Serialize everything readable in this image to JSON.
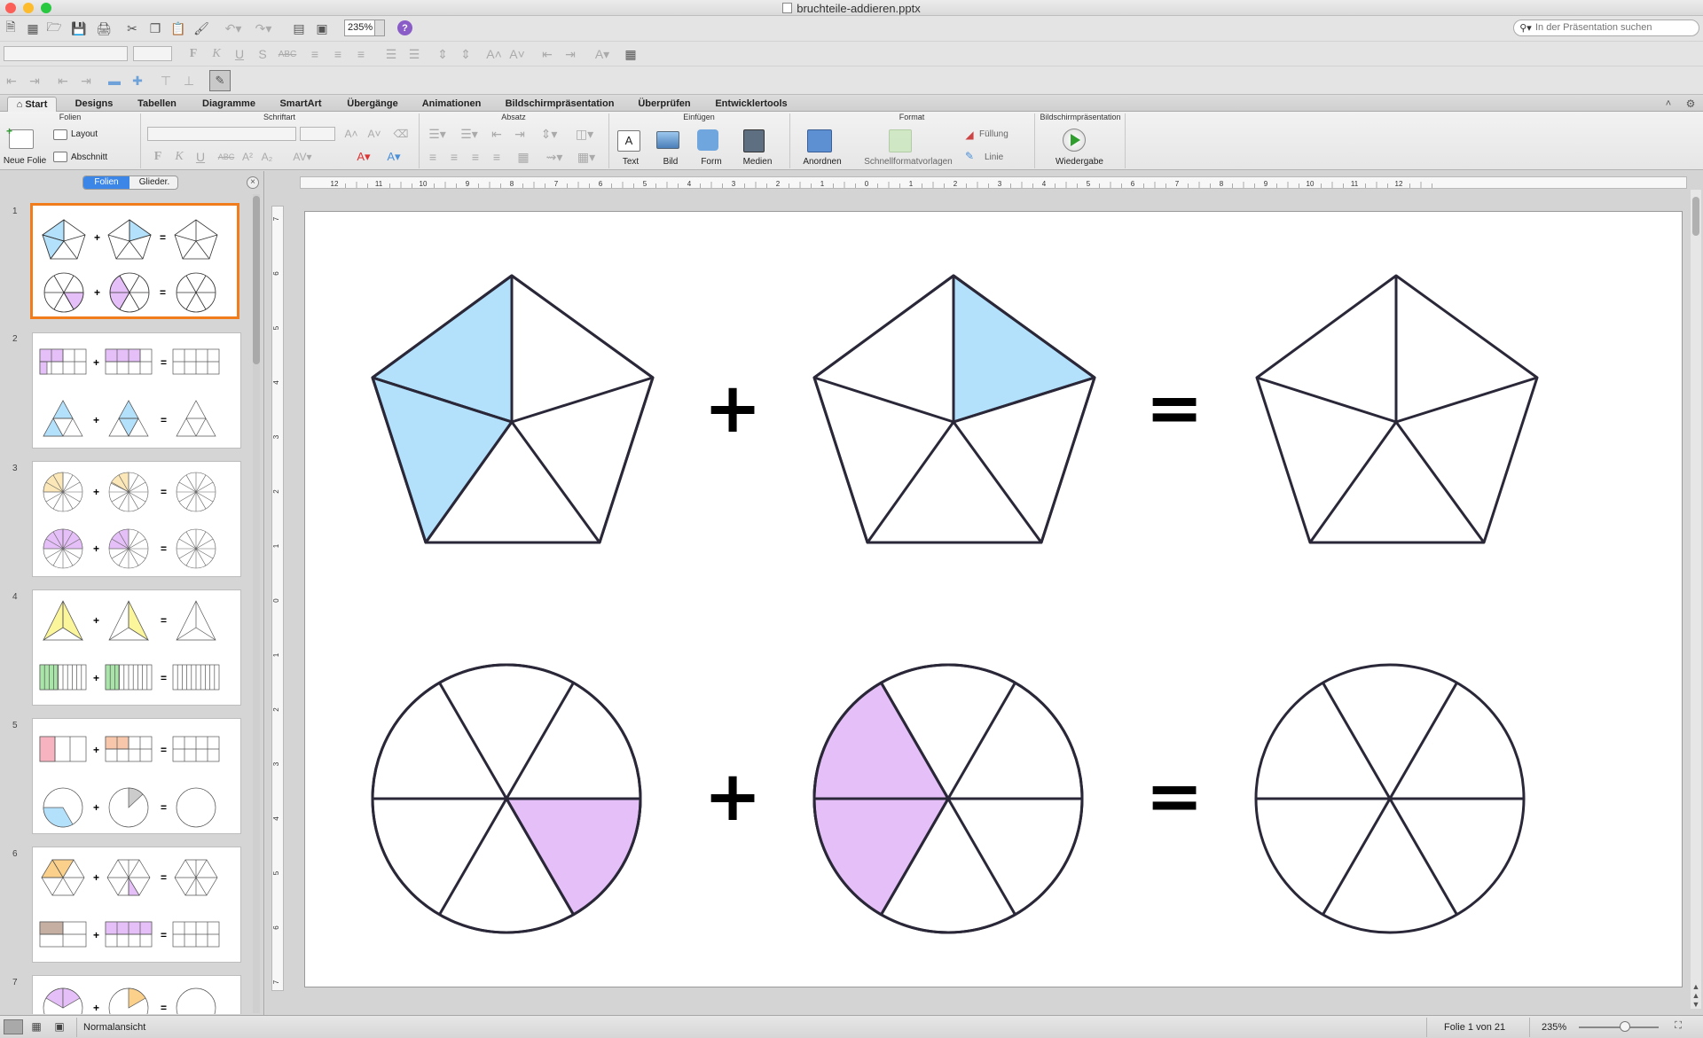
{
  "window": {
    "title": "bruchteile-addieren.pptx",
    "traffic_lights": {
      "close": "#fc5f57",
      "minimize": "#fdbc2e",
      "zoom": "#28c840"
    }
  },
  "toolbar": {
    "zoom_value": "235%",
    "search_placeholder": "In der Präsentation suchen"
  },
  "ribbon_tabs": [
    {
      "label": "Start",
      "active": true
    },
    {
      "label": "Designs"
    },
    {
      "label": "Tabellen"
    },
    {
      "label": "Diagramme"
    },
    {
      "label": "SmartArt"
    },
    {
      "label": "Übergänge"
    },
    {
      "label": "Animationen"
    },
    {
      "label": "Bildschirmpräsentation"
    },
    {
      "label": "Überprüfen"
    },
    {
      "label": "Entwicklertools"
    }
  ],
  "ribbon": {
    "groups": {
      "folien": "Folien",
      "schriftart": "Schriftart",
      "absatz": "Absatz",
      "einfuegen": "Einfügen",
      "format": "Format",
      "bildschirm": "Bildschirmpräsentation"
    },
    "buttons": {
      "neue_folie": "Neue Folie",
      "layout": "Layout",
      "abschnitt": "Abschnitt",
      "text": "Text",
      "bild": "Bild",
      "form": "Form",
      "medien": "Medien",
      "anordnen": "Anordnen",
      "schnellformat": "Schnellformatvorlagen",
      "fuellung": "Füllung",
      "linie": "Linie",
      "wiedergabe": "Wiedergabe"
    }
  },
  "left_pane": {
    "tab_folien": "Folien",
    "tab_glieder": "Glieder.",
    "slide_numbers": [
      "1",
      "2",
      "3",
      "4",
      "5",
      "6",
      "7"
    ]
  },
  "slide": {
    "row1": {
      "plus": "+",
      "equals": "=",
      "fill": "#b3e0fb"
    },
    "row2": {
      "plus": "+",
      "equals": "=",
      "fill": "#e5bff7"
    }
  },
  "ruler": {
    "h_ticks": [
      "12",
      "11",
      "10",
      "9",
      "8",
      "7",
      "6",
      "5",
      "4",
      "3",
      "2",
      "1",
      "0",
      "1",
      "2",
      "3",
      "4",
      "5",
      "6",
      "7",
      "8",
      "9",
      "10",
      "11",
      "12"
    ],
    "v_ticks": [
      "7",
      "6",
      "5",
      "4",
      "3",
      "2",
      "1",
      "0",
      "1",
      "2",
      "3",
      "4",
      "5",
      "6",
      "7"
    ]
  },
  "status": {
    "view": "Normalansicht",
    "slide_counter": "Folie 1 von 21",
    "zoom": "235%"
  },
  "colors": {
    "accent_selected": "#f07c1b",
    "tab_blue": "#3b86e6"
  }
}
